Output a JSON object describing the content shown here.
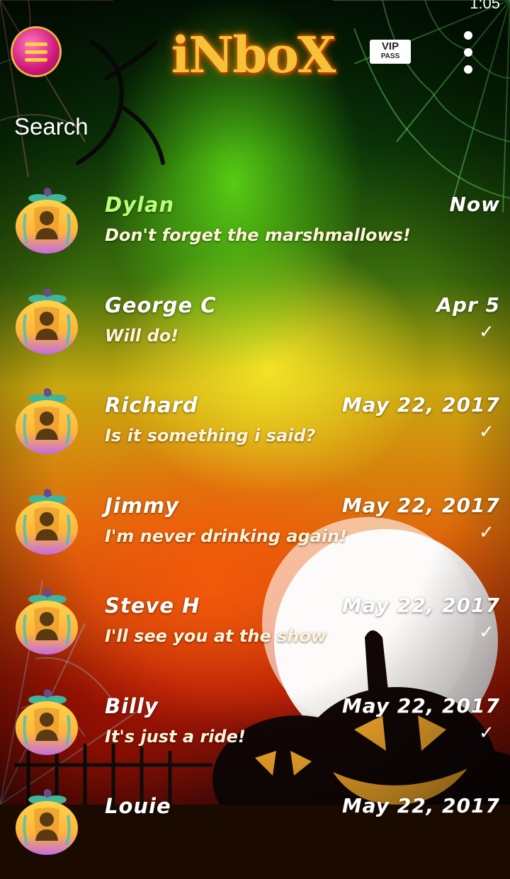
{
  "header": {
    "status_text": "1:05",
    "logo_text": "iNboX",
    "vip_line1": "VIP",
    "vip_line2": "PASS",
    "search_label": "Search"
  },
  "icons": {
    "menu": "hamburger-menu-icon",
    "more": "more-vertical-icon",
    "avatar": "pumpkin-contact-avatar-icon",
    "read": "checkmark-icon"
  },
  "colors": {
    "unread_name": "#b8ff7a",
    "menu_button": "#d0187a",
    "menu_lines": "#ffd23c"
  },
  "conversations": [
    {
      "name": "Dylan",
      "snippet": "Don't forget the marshmallows!",
      "date": "Now",
      "unread": true,
      "read_check": false
    },
    {
      "name": "George C",
      "snippet": "Will do!",
      "date": "Apr 5",
      "unread": false,
      "read_check": true
    },
    {
      "name": "Richard",
      "snippet": "Is it something i said?",
      "date": "May 22, 2017",
      "unread": false,
      "read_check": true
    },
    {
      "name": "Jimmy",
      "snippet": "I'm never drinking again!",
      "date": "May 22, 2017",
      "unread": false,
      "read_check": true
    },
    {
      "name": "Steve H",
      "snippet": "I'll see you at the show",
      "date": "May 22, 2017",
      "unread": false,
      "read_check": true
    },
    {
      "name": "Billy",
      "snippet": "It's just a ride!",
      "date": "May 22, 2017",
      "unread": false,
      "read_check": true
    },
    {
      "name": "Louie",
      "snippet": "",
      "date": "May 22, 2017",
      "unread": false,
      "read_check": false
    }
  ]
}
